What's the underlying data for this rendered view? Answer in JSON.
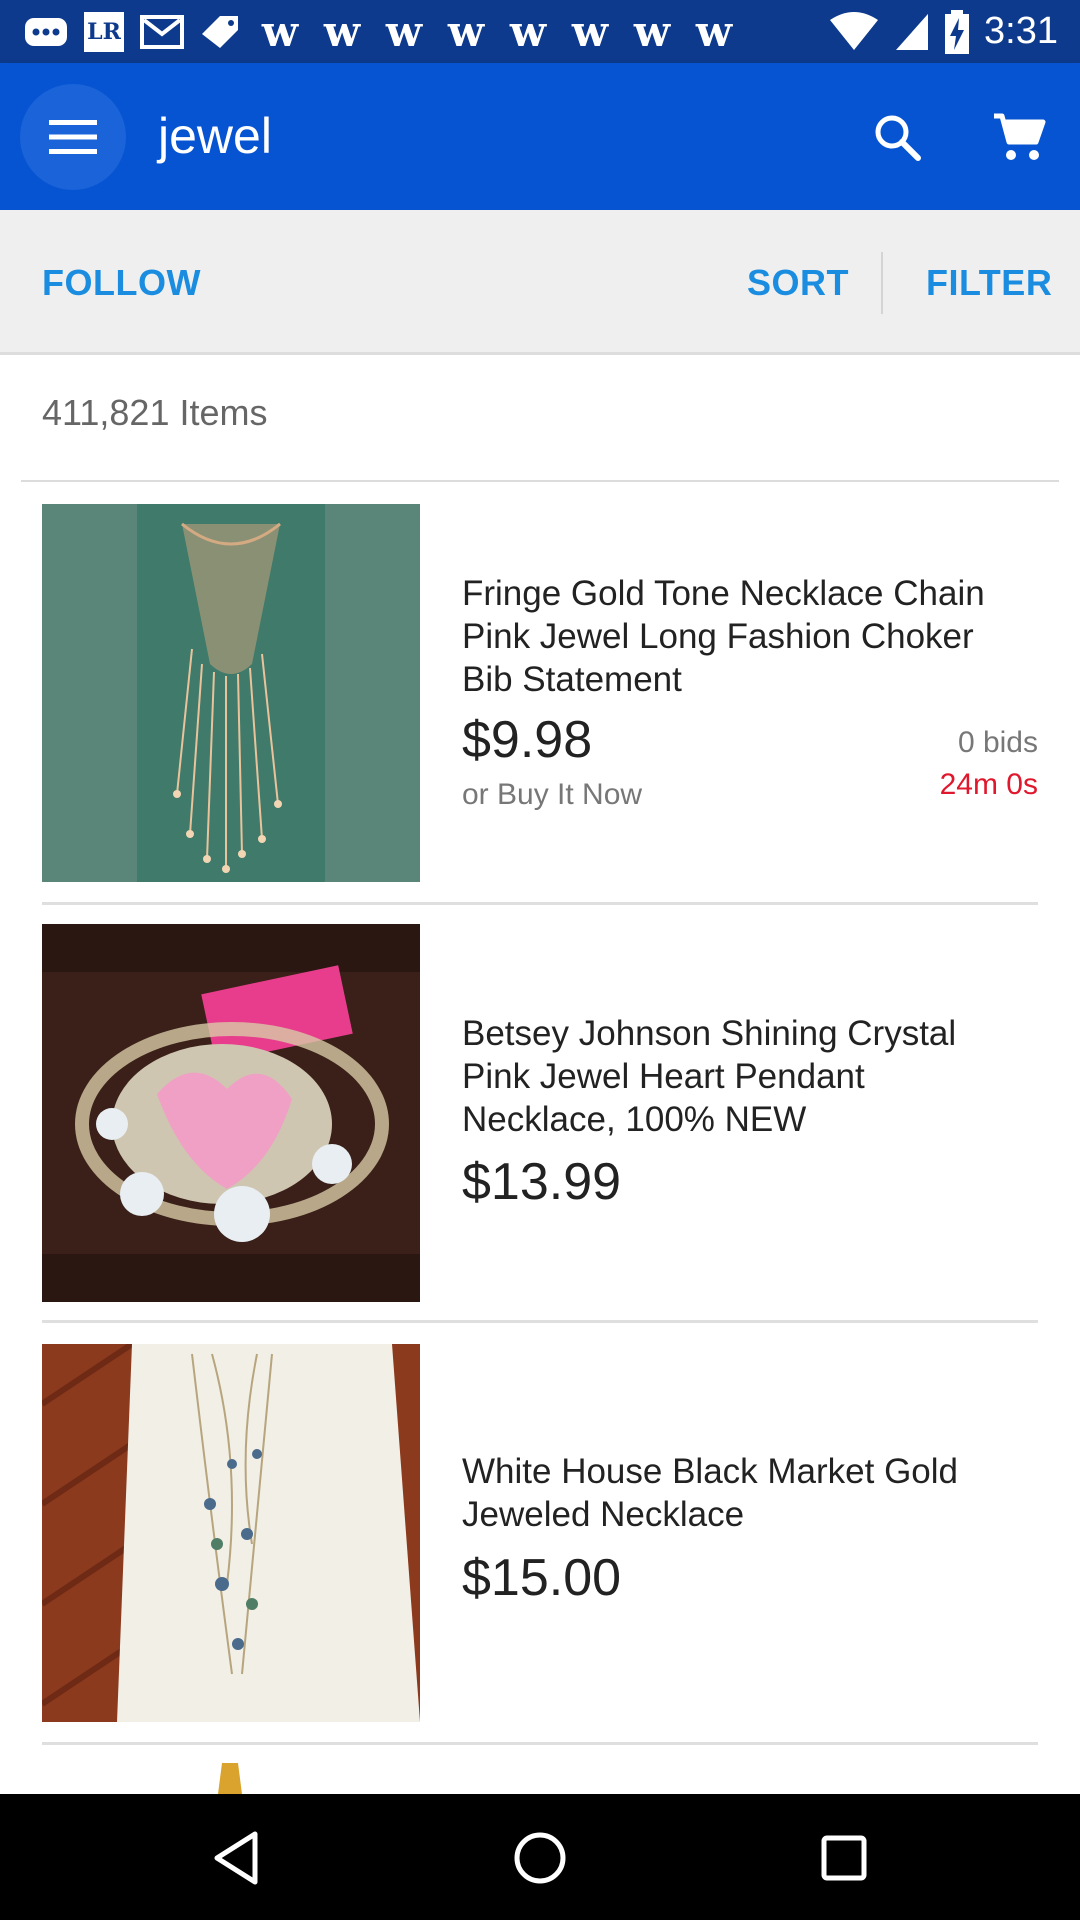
{
  "status_bar": {
    "time": "3:31",
    "notification_icons": [
      "chat-icon",
      "lr-icon",
      "mail-icon",
      "tag-icon",
      "w-icon",
      "w-icon",
      "w-icon",
      "w-icon",
      "w-icon",
      "w-icon",
      "w-icon",
      "w-icon"
    ],
    "lr_label": "LR",
    "w_label": "w"
  },
  "app_bar": {
    "search_query": "jewel"
  },
  "actions": {
    "follow": "FOLLOW",
    "sort": "SORT",
    "filter": "FILTER"
  },
  "results": {
    "count": "411,821 Items"
  },
  "listings": [
    {
      "title": "Fringe Gold Tone Necklace Chain Pink Jewel Long Fashion Choker Bib Statement",
      "price": "$9.98",
      "buy_it_now": "or Buy It Now",
      "bids": "0 bids",
      "time_left": "24m 0s"
    },
    {
      "title": "Betsey Johnson Shining Crystal Pink Jewel Heart Pendant Necklace, 100% NEW",
      "price": "$13.99"
    },
    {
      "title": "White House Black Market Gold Jeweled Necklace",
      "price": "$15.00"
    }
  ],
  "colors": {
    "status_bar": "#0d3a8c",
    "app_bar": "#0654d2",
    "action_text": "#1a8de0",
    "time_left": "#e0182d"
  }
}
